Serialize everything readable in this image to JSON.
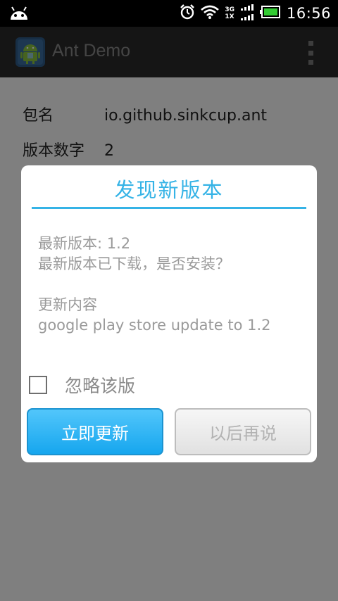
{
  "status_bar": {
    "time": "16:56",
    "network_top": "3G",
    "network_bottom": "1X",
    "icons": [
      "android-debug-icon",
      "alarm-clock-icon",
      "wifi-icon",
      "signal-icon",
      "battery-icon"
    ]
  },
  "action_bar": {
    "title": "Ant Demo",
    "icons": [
      "app-launcher-icon",
      "overflow-menu-icon"
    ]
  },
  "info": {
    "package_label": "包名",
    "package_value": "io.github.sinkcup.ant",
    "version_label": "版本数字",
    "version_value": "2"
  },
  "dialog": {
    "title": "发现新版本",
    "latest_version": "最新版本: 1.2",
    "downloaded_prompt": "最新版本已下载，是否安装？",
    "changelog_label": "更新内容",
    "changelog_text": "google play store update to 1.2",
    "ignore_label": "忽略该版",
    "ignore_checked": false,
    "primary_button": "立即更新",
    "secondary_button": "以后再说"
  },
  "colors": {
    "accent": "#35b3e6",
    "primary_button": "#22aaf0",
    "status_bar": "#000000",
    "action_bar": "#2b2b2b"
  }
}
